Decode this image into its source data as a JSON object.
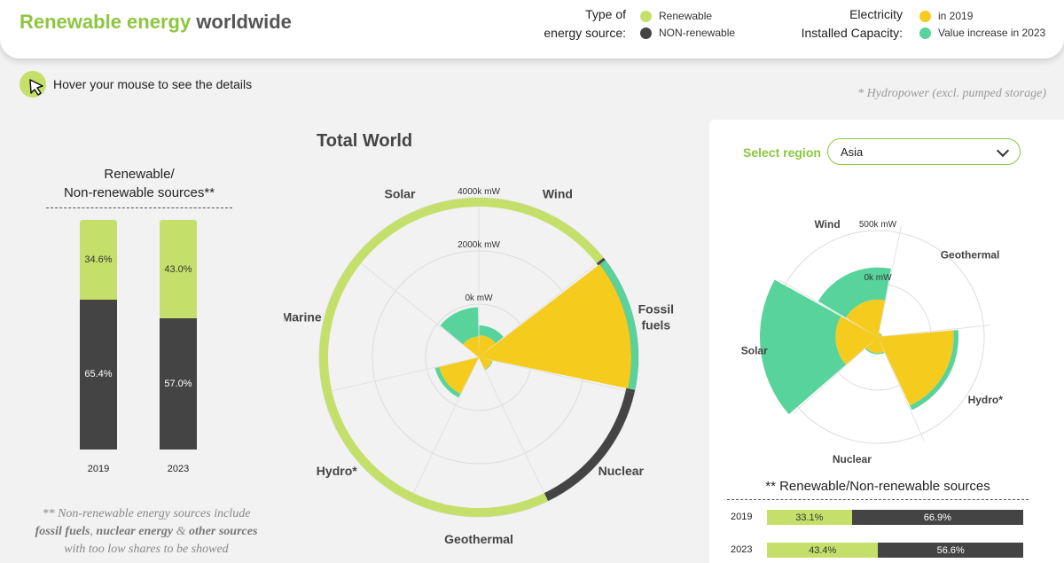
{
  "header": {
    "title_green": "Renewable energy",
    "title_dark": "worldwide",
    "type_heading": [
      "Type of",
      "energy source:"
    ],
    "capacity_heading": [
      "Electricity",
      "Installed Capacity:"
    ],
    "type_legend": [
      {
        "label": "Renewable",
        "color": "#c5e06a"
      },
      {
        "label": "NON-renewable",
        "color": "#444444"
      }
    ],
    "capacity_legend": [
      {
        "label": "in 2019",
        "color": "#f5cc1e"
      },
      {
        "label": "Value increase in 2023",
        "color": "#58d39b"
      }
    ]
  },
  "hint": "Hover your mouse to see the details",
  "hydro_note": "* Hydropower (excl. pumped storage)",
  "left": {
    "title": [
      "Renewable/",
      "Non-renewable sources**"
    ],
    "note_line1": "** Non-renewable energy sources include",
    "note_b1": "fossil fuels",
    "note_b2": "nuclear energy",
    "note_amp": "&",
    "note_b3": "other sources",
    "note_line3": "with too low shares to be showed"
  },
  "center": {
    "title": "Total World"
  },
  "right": {
    "select_label": "Select region",
    "select_value": "Asia",
    "section_title": "** Renewable/Non-renewable sources"
  },
  "chart_data": [
    {
      "type": "bar",
      "title": "Renewable/ Non-renewable sources**",
      "categories": [
        "2019",
        "2023"
      ],
      "stacked": true,
      "percent": true,
      "series": [
        {
          "name": "Renewable",
          "values": [
            34.6,
            43.0
          ],
          "labels": [
            "34.6%",
            "43.0%"
          ],
          "color": "#c5e06a"
        },
        {
          "name": "NON-renewable",
          "values": [
            65.4,
            57.0
          ],
          "labels": [
            "65.4%",
            "57.0%"
          ],
          "color": "#444444"
        }
      ]
    },
    {
      "type": "bar",
      "subtype": "polar",
      "title": "Total World",
      "unit": "k mW",
      "ticks": [
        "0k mW",
        "2000k mW",
        "4000k mW"
      ],
      "rmax": 5000,
      "categories": [
        "Wind",
        "Fossil fuels",
        "Nuclear",
        "Geothermal",
        "Hydro*",
        "Marine",
        "Solar"
      ],
      "category_type": [
        "Renewable",
        "NON-renewable",
        "NON-renewable",
        "Renewable",
        "Renewable",
        "Renewable",
        "Renewable"
      ],
      "series": [
        {
          "name": "in 2019",
          "values": [
            620,
            4300,
            380,
            15,
            1150,
            1,
            580
          ]
        },
        {
          "name": "Value increase in 2023",
          "values": [
            280,
            200,
            20,
            2,
            120,
            0,
            830
          ]
        }
      ]
    },
    {
      "type": "bar",
      "subtype": "polar",
      "title": "Asia",
      "unit": "k mW",
      "ticks": [
        "0k mW",
        "500k mW"
      ],
      "rmax": 1000,
      "categories": [
        "Geothermal",
        "Hydro*",
        "Nuclear",
        "Solar",
        "Wind"
      ],
      "series": [
        {
          "name": "in 2019",
          "values": [
            30,
            610,
            130,
            340,
            300
          ]
        },
        {
          "name": "Value increase in 2023",
          "values": [
            5,
            40,
            10,
            610,
            260
          ]
        }
      ]
    },
    {
      "type": "bar",
      "subtype": "horizontal-stacked",
      "title": "** Renewable/Non-renewable sources",
      "categories": [
        "2019",
        "2023"
      ],
      "percent": true,
      "series": [
        {
          "name": "Renewable",
          "values": [
            33.1,
            43.4
          ],
          "labels": [
            "33.1%",
            "43.4%"
          ]
        },
        {
          "name": "NON-renewable",
          "values": [
            66.9,
            56.6
          ],
          "labels": [
            "66.9%",
            "56.6%"
          ]
        }
      ]
    }
  ]
}
